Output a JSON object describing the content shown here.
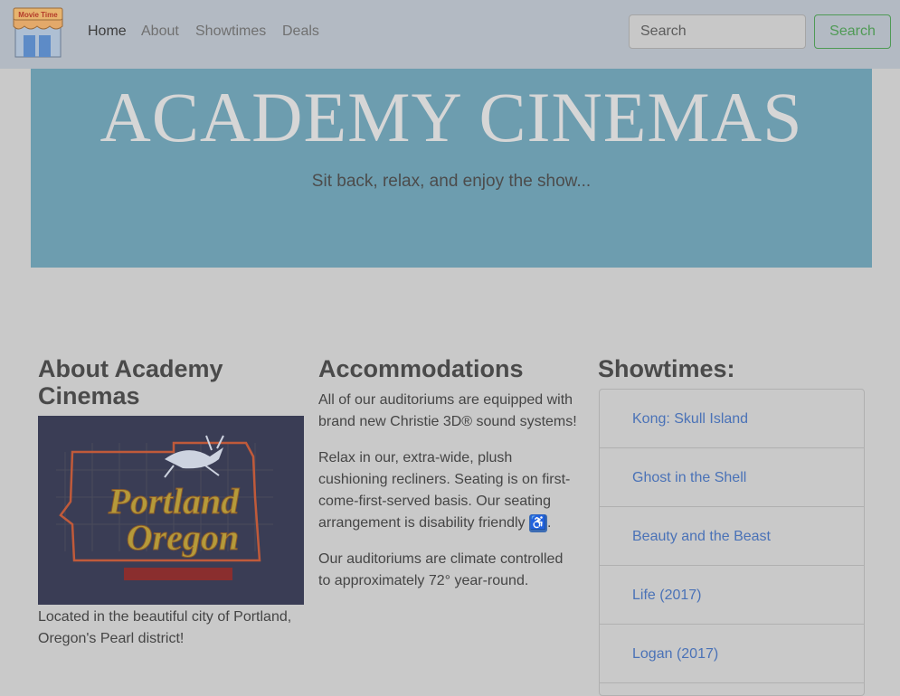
{
  "nav": {
    "logo_text": "Movie Time",
    "links": [
      {
        "label": "Home"
      },
      {
        "label": "About"
      },
      {
        "label": "Showtimes"
      },
      {
        "label": "Deals"
      }
    ],
    "search": {
      "placeholder": "Search",
      "button_label": "Search"
    }
  },
  "hero": {
    "title": "ACADEMY CINEMAS",
    "subtitle": "Sit back, relax, and enjoy the show..."
  },
  "about": {
    "heading_line1": "About Academy",
    "heading_line2": "Cinemas",
    "image_sign_line1": "Portland",
    "image_sign_line2": "Oregon",
    "caption_line1": "Located in the beautiful city of Portland,",
    "caption_line2": "Oregon's Pearl district!"
  },
  "accommodations": {
    "heading": "Accommodations",
    "p1": [
      "All of our auditoriums are equipped with",
      "brand new Christie 3D® sound systems!"
    ],
    "p2": [
      "Relax in our, extra-wide, plush",
      "cushioning recliners. Seating is on first-",
      "come-first-served basis. Our seating",
      "arrangement is disability friendly",
      "."
    ],
    "p3": [
      "Our auditoriums are climate controlled",
      "to approximately 72° year-round."
    ],
    "wheelchair_icon": "wheelchair-icon"
  },
  "showtimes": {
    "heading": "Showtimes:",
    "items": [
      {
        "title": "Kong: Skull Island"
      },
      {
        "title": "Ghost in the Shell"
      },
      {
        "title": "Beauty and the Beast"
      },
      {
        "title": "Life (2017)"
      },
      {
        "title": "Logan (2017)"
      }
    ]
  },
  "colors": {
    "navbar": "#b3bac3",
    "hero": "#6d9daf",
    "page": "#c9c9c9",
    "link": "#4a72b7",
    "search_button": "#4f9a55"
  }
}
